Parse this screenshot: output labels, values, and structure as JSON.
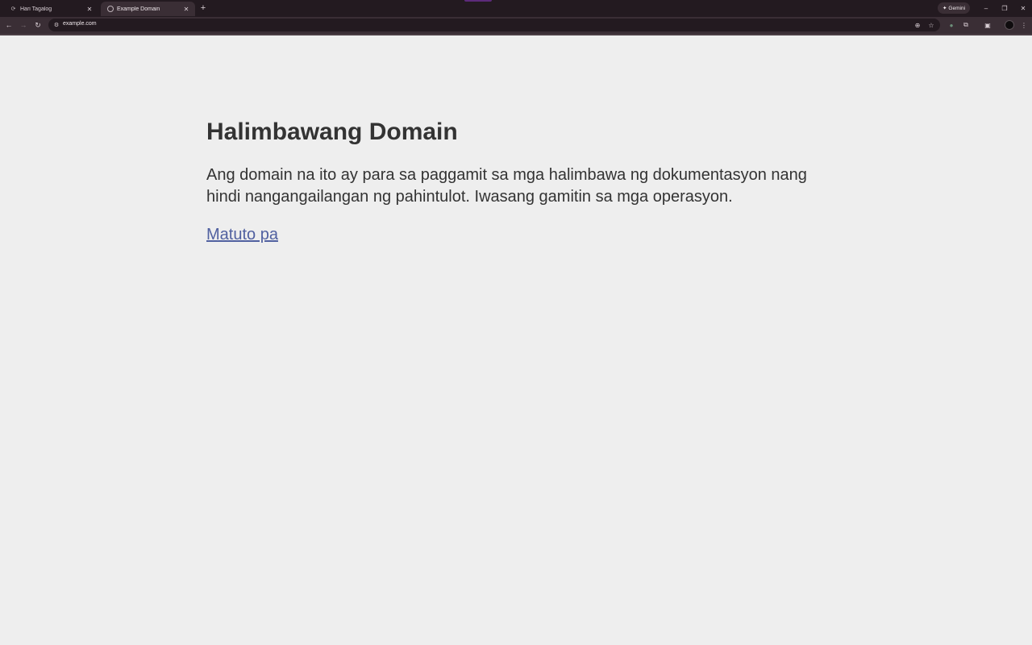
{
  "browser": {
    "tabs": [
      {
        "title": "Hari Tagalog",
        "active": false
      },
      {
        "title": "Example Domain",
        "active": true
      }
    ],
    "gemini_label": "Gemini",
    "url": "example.com",
    "accent_color": "#231a20"
  },
  "page": {
    "heading": "Halimbawang Domain",
    "paragraph": "Ang domain na ito ay para sa paggamit sa mga halimbawa ng dokumentasyon nang hindi nangangailangan ng pahintulot. Iwasang gamitin sa mga operasyon.",
    "link_text": "Matuto pa",
    "link_color": "#5060a0",
    "background_color": "#eeeeee",
    "text_color": "#333333"
  },
  "icons": {
    "back": "arrow-left-icon",
    "forward": "arrow-right-icon",
    "reload": "reload-icon",
    "site_info": "tune-icon",
    "zoom": "zoom-icon",
    "bookmark": "star-icon",
    "extensions": "puzzle-icon",
    "split": "split-view-icon",
    "profile": "avatar-icon",
    "menu": "kebab-menu-icon"
  }
}
